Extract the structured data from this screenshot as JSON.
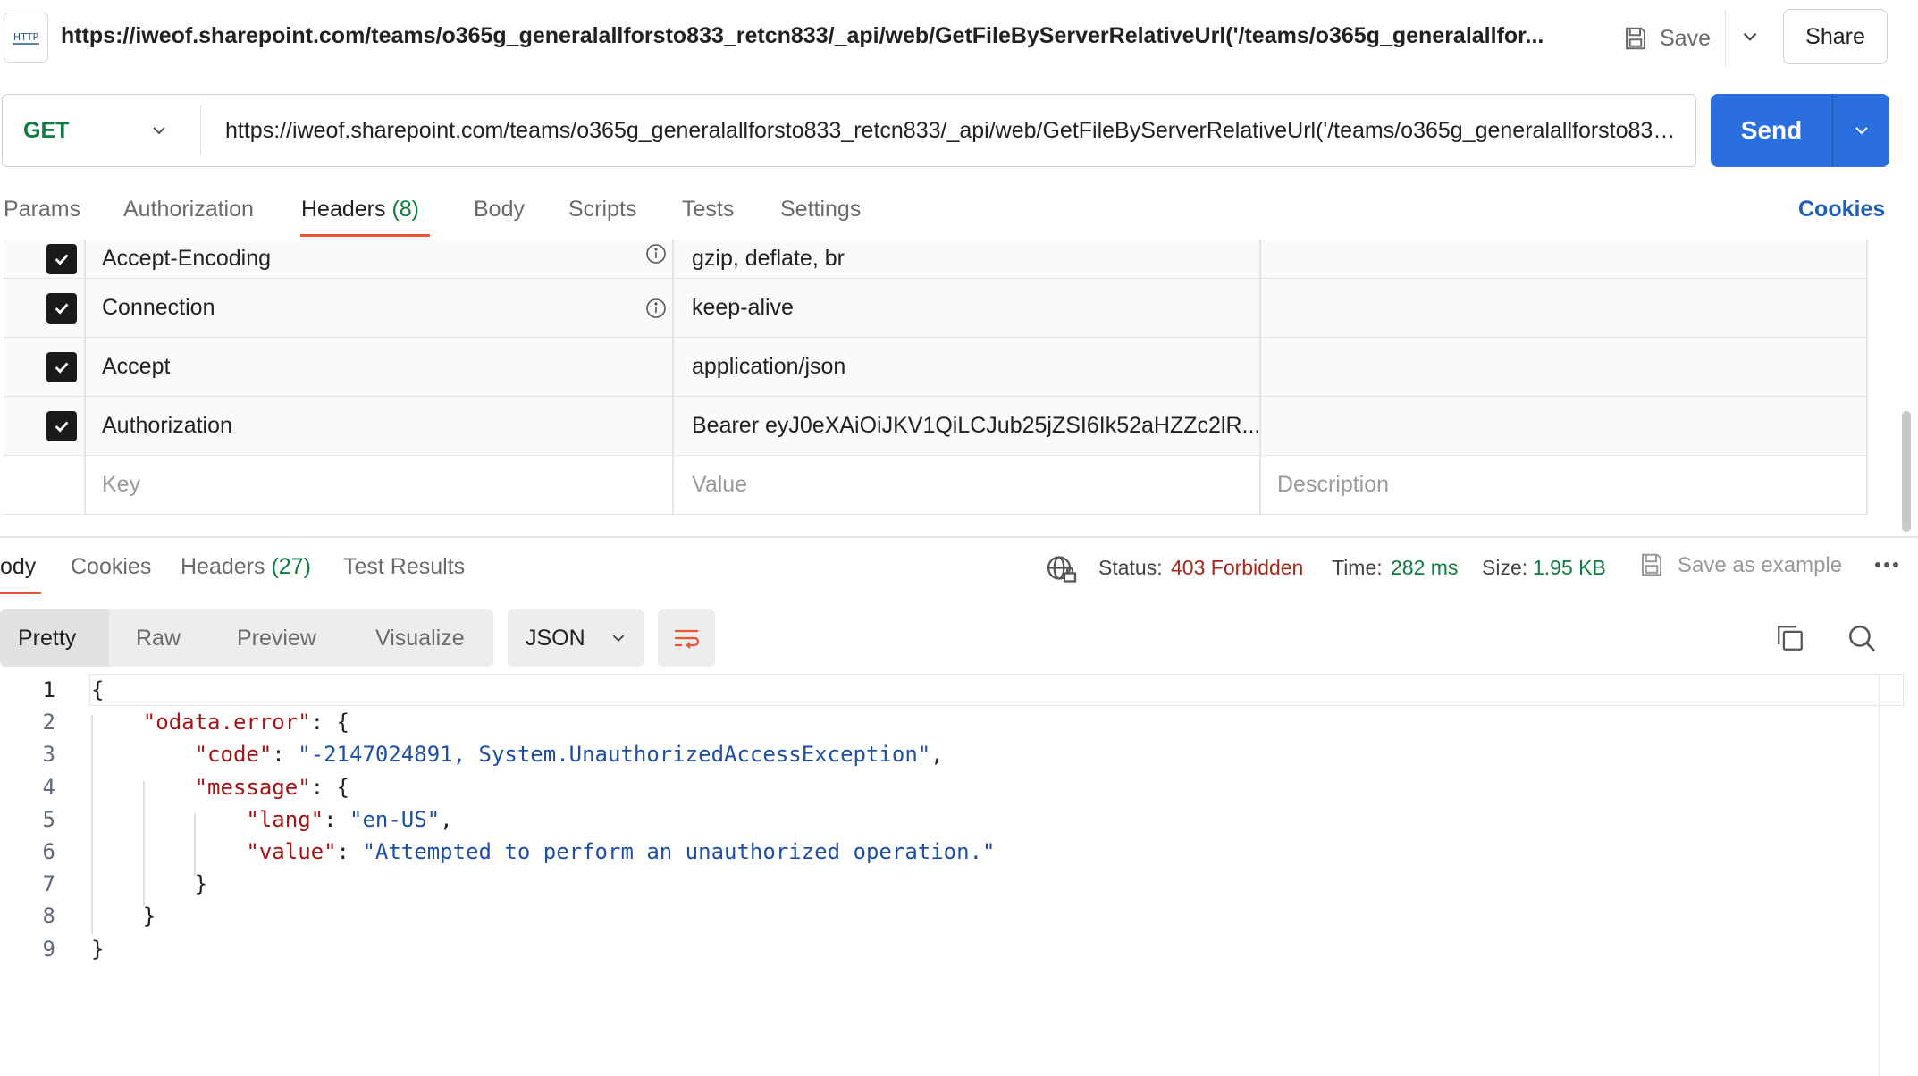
{
  "top_bar": {
    "icon": "http-icon",
    "icon_text": "HTTP",
    "title": "https://iweof.sharepoint.com/teams/o365g_generalallforsto833_retcn833/_api/web/GetFileByServerRelativeUrl('/teams/o365g_generalallfor...",
    "save_label": "Save",
    "share_label": "Share"
  },
  "request": {
    "method": "GET",
    "url": "https://iweof.sharepoint.com/teams/o365g_generalallforsto833_retcn833/_api/web/GetFileByServerRelativeUrl('/teams/o365g_generalallforsto833_retcn833/...",
    "send_label": "Send",
    "tabs": [
      {
        "label": "Params"
      },
      {
        "label": "Authorization"
      },
      {
        "label": "Headers",
        "count": "(8)"
      },
      {
        "label": "Body"
      },
      {
        "label": "Scripts"
      },
      {
        "label": "Tests"
      },
      {
        "label": "Settings"
      }
    ],
    "active_tab": "Headers",
    "cookies_label": "Cookies"
  },
  "headers_table": {
    "rows": [
      {
        "key": "Accept-Encoding",
        "value": "gzip, deflate, br",
        "checked": true,
        "info": true
      },
      {
        "key": "Connection",
        "value": "keep-alive",
        "checked": true,
        "info": true
      },
      {
        "key": "Accept",
        "value": "application/json",
        "checked": true,
        "info": false
      },
      {
        "key": "Authorization",
        "value": "Bearer eyJ0eXAiOiJKV1QiLCJub25jZSI6Ik52aHZZc2lR...",
        "checked": true,
        "info": false
      }
    ],
    "placeholder": {
      "key": "Key",
      "value": "Value",
      "description": "Description"
    }
  },
  "response": {
    "tabs": [
      {
        "label": "ody"
      },
      {
        "label": "Cookies"
      },
      {
        "label": "Headers",
        "count": "(27)"
      },
      {
        "label": "Test Results"
      }
    ],
    "status_label": "Status:",
    "status_value": "403 Forbidden",
    "time_label": "Time:",
    "time_value": "282 ms",
    "size_label": "Size:",
    "size_value": "1.95 KB",
    "save_example_label": "Save as example",
    "more_label": "ooo",
    "view_tabs": [
      "Pretty",
      "Raw",
      "Preview",
      "Visualize"
    ],
    "format": "JSON",
    "colors": {
      "status_error": "#a52a1a",
      "status_ok": "#0f7b3f",
      "accent": "#e8552f",
      "send": "#2b6fde"
    },
    "code_lines": [
      {
        "n": "1",
        "parts": [
          [
            "p",
            "{"
          ]
        ]
      },
      {
        "n": "2",
        "parts": [
          [
            "p",
            "    "
          ],
          [
            "k",
            "\"odata.error\""
          ],
          [
            "p",
            ": {"
          ]
        ]
      },
      {
        "n": "3",
        "parts": [
          [
            "p",
            "        "
          ],
          [
            "k",
            "\"code\""
          ],
          [
            "p",
            ": "
          ],
          [
            "s",
            "\"-2147024891, System.UnauthorizedAccessException\""
          ],
          [
            "p",
            ","
          ]
        ]
      },
      {
        "n": "4",
        "parts": [
          [
            "p",
            "        "
          ],
          [
            "k",
            "\"message\""
          ],
          [
            "p",
            ": {"
          ]
        ]
      },
      {
        "n": "5",
        "parts": [
          [
            "p",
            "            "
          ],
          [
            "k",
            "\"lang\""
          ],
          [
            "p",
            ": "
          ],
          [
            "s",
            "\"en-US\""
          ],
          [
            "p",
            ","
          ]
        ]
      },
      {
        "n": "6",
        "parts": [
          [
            "p",
            "            "
          ],
          [
            "k",
            "\"value\""
          ],
          [
            "p",
            ": "
          ],
          [
            "s",
            "\"Attempted to perform an unauthorized operation.\""
          ]
        ]
      },
      {
        "n": "7",
        "parts": [
          [
            "p",
            "        }"
          ]
        ]
      },
      {
        "n": "8",
        "parts": [
          [
            "p",
            "    }"
          ]
        ]
      },
      {
        "n": "9",
        "parts": [
          [
            "p",
            "}"
          ]
        ]
      }
    ]
  }
}
